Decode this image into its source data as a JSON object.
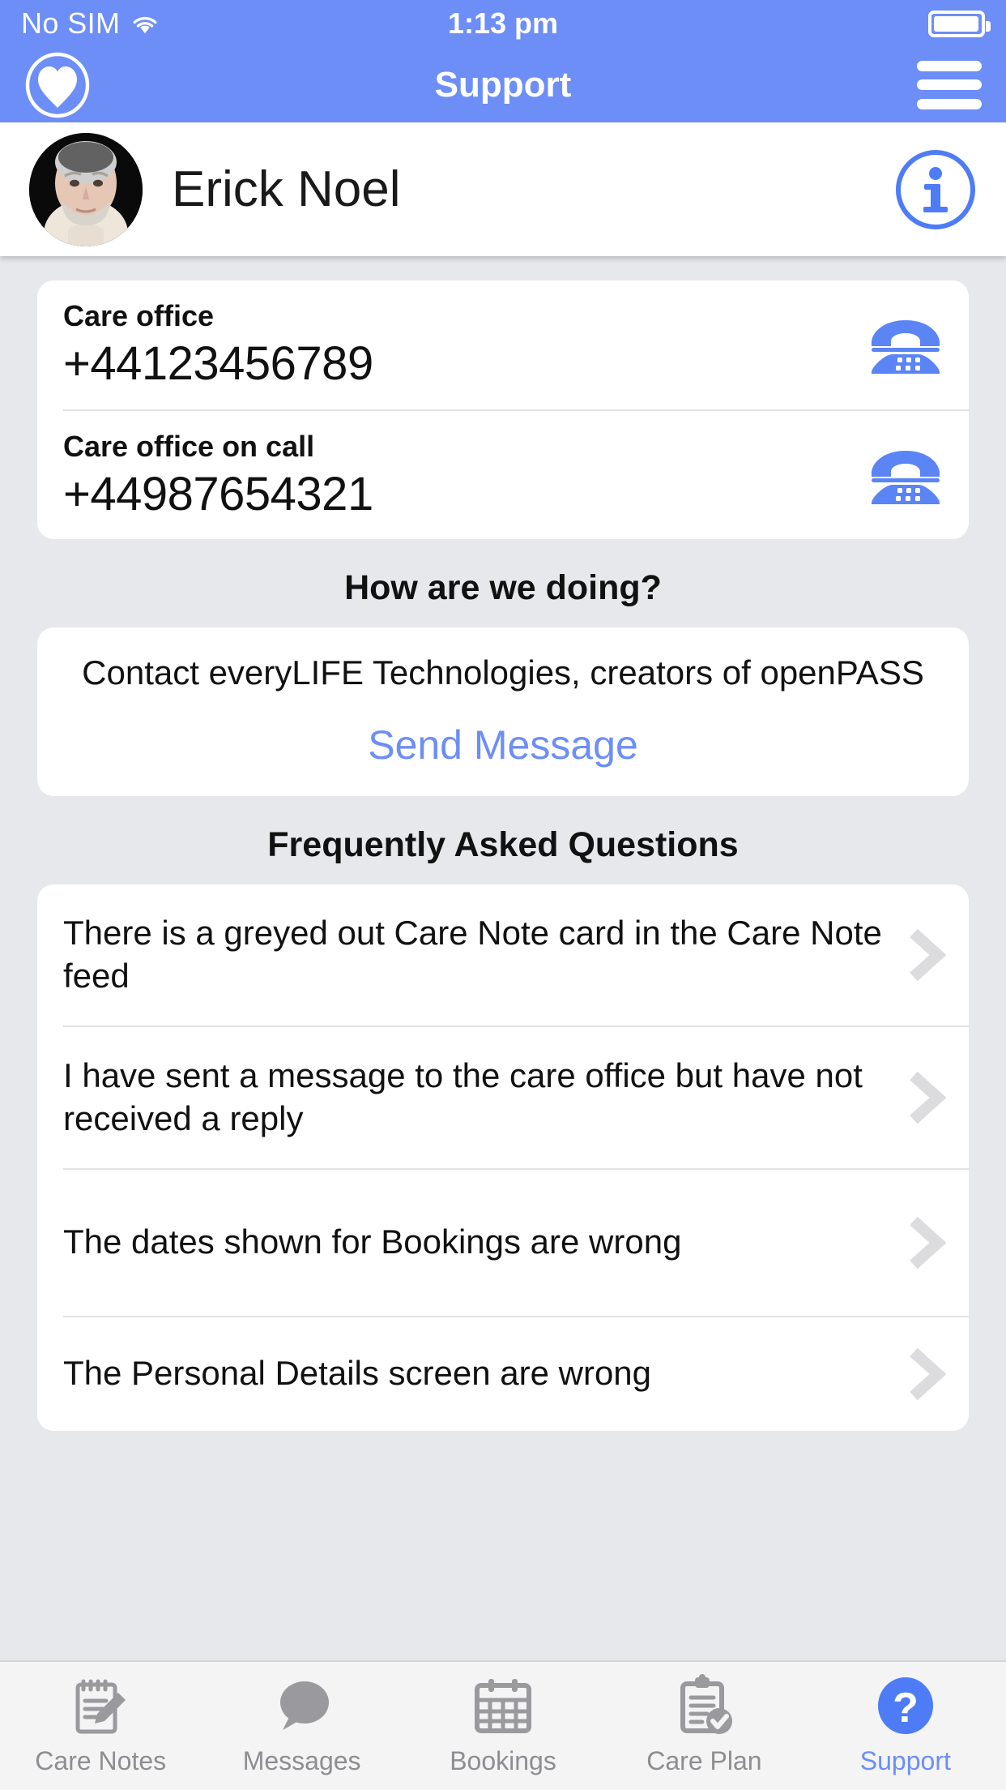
{
  "status_bar": {
    "carrier": "No SIM",
    "time": "1:13 pm",
    "wifi_icon": "wifi-icon",
    "battery_icon": "battery-icon"
  },
  "nav_bar": {
    "title": "Support",
    "heart_icon": "heart-icon",
    "menu_icon": "hamburger-menu-icon"
  },
  "profile": {
    "name": "Erick Noel",
    "avatar_icon": "avatar",
    "info_icon": "info-icon"
  },
  "contacts": [
    {
      "label": "Care office",
      "number": "+44123456789",
      "icon": "telephone-icon"
    },
    {
      "label": "Care office on call",
      "number": "+44987654321",
      "icon": "telephone-icon"
    }
  ],
  "feedback": {
    "heading": "How are we doing?",
    "body": "Contact everyLIFE Technologies, creators of openPASS",
    "action_label": "Send Message"
  },
  "faq": {
    "heading": "Frequently Asked Questions",
    "items": [
      {
        "question": "There is a greyed out Care Note card in the Care Note feed",
        "chevron": "chevron-right-icon"
      },
      {
        "question": "I have sent a message to the care office but have not received a reply",
        "chevron": "chevron-right-icon"
      },
      {
        "question": "The dates shown for Bookings are wrong",
        "chevron": "chevron-right-icon"
      },
      {
        "question": "The Personal Details screen are wrong",
        "chevron": "chevron-right-icon"
      }
    ]
  },
  "tab_bar": {
    "tabs": [
      {
        "label": "Care Notes",
        "icon": "care-notes-icon",
        "active": false
      },
      {
        "label": "Messages",
        "icon": "messages-icon",
        "active": false
      },
      {
        "label": "Bookings",
        "icon": "bookings-calendar-icon",
        "active": false
      },
      {
        "label": "Care Plan",
        "icon": "care-plan-clipboard-icon",
        "active": false
      },
      {
        "label": "Support",
        "icon": "support-question-icon",
        "active": true
      }
    ]
  },
  "colors": {
    "accent": "#6d8ef6",
    "page_background": "#e7e8ec",
    "card_background": "#ffffff",
    "tab_inactive": "#8d8d92",
    "chevron": "#dcdcdf"
  }
}
